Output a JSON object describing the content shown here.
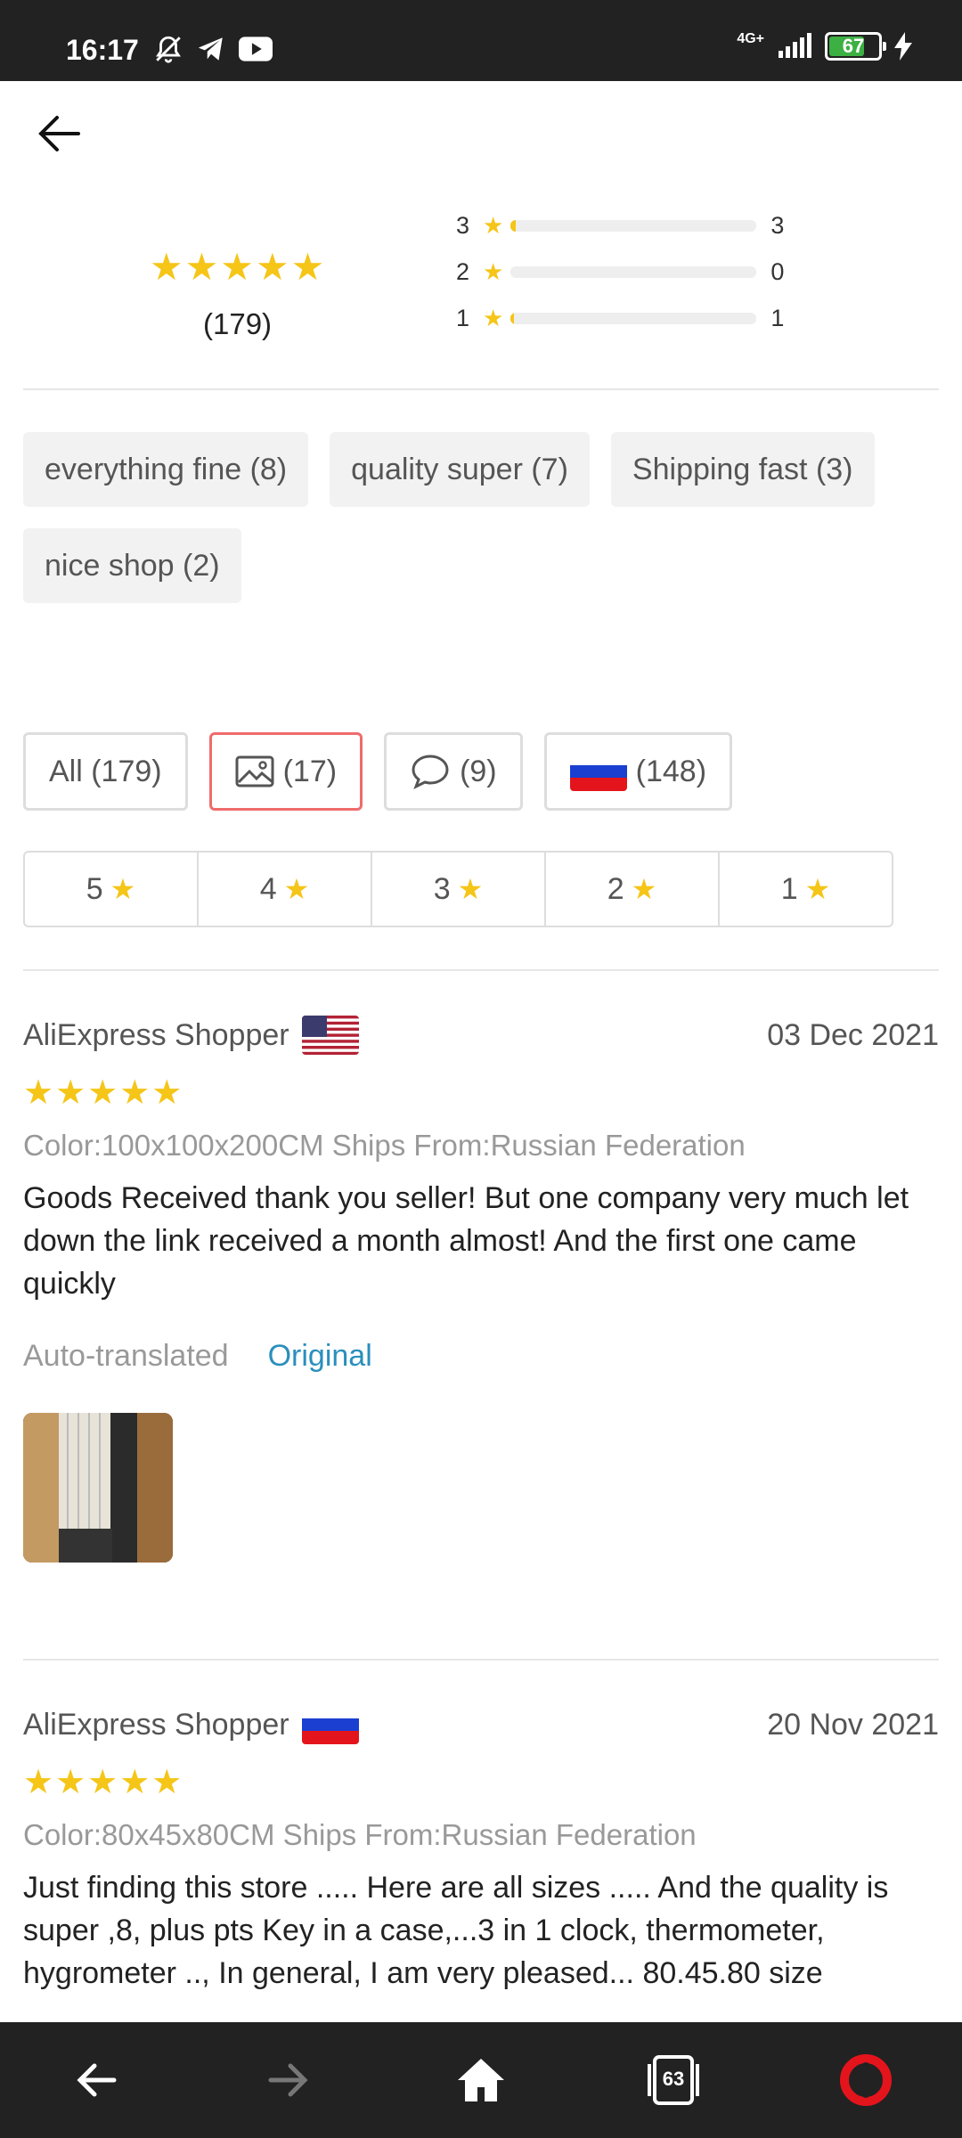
{
  "status": {
    "time": "16:17",
    "network": "4G+",
    "battery": "67"
  },
  "summary": {
    "total": "(179)",
    "distribution": [
      {
        "stars": "3",
        "count": "3",
        "fraction": 0.02
      },
      {
        "stars": "2",
        "count": "0",
        "fraction": 0.0
      },
      {
        "stars": "1",
        "count": "1",
        "fraction": 0.01
      }
    ]
  },
  "tags": [
    "everything fine (8)",
    "quality super (7)",
    "Shipping fast (3)",
    "nice shop (2)"
  ],
  "filters": {
    "all": "All (179)",
    "photos": "(17)",
    "comments": "(9)",
    "country": "(148)"
  },
  "star_filters": [
    "5",
    "4",
    "3",
    "2",
    "1"
  ],
  "reviews": [
    {
      "name": "AliExpress Shopper",
      "country": "US",
      "date": "03 Dec 2021",
      "attrs": "Color:100x100x200CM Ships From:Russian Federation",
      "text": "Goods Received thank you seller! But one company very much let down the link received a month almost! And the first one came quickly",
      "auto": "Auto-translated",
      "original": "Original"
    },
    {
      "name": "AliExpress Shopper",
      "country": "RU",
      "date": "20 Nov 2021",
      "attrs": "Color:80x45x80CM Ships From:Russian Federation",
      "text": "Just finding this store ..... Here are all sizes ..... And the quality is super ,8, plus pts Key in a case,...3 in 1 clock, thermometer, hygrometer .., In general, I am very pleased... 80.45.80 size"
    }
  ],
  "nav": {
    "tabs_count": "63"
  },
  "colors": {
    "star": "#f5c518",
    "active_filter": "#f06b6b",
    "link": "#2a8fbd",
    "bar_bg": "#222222"
  }
}
